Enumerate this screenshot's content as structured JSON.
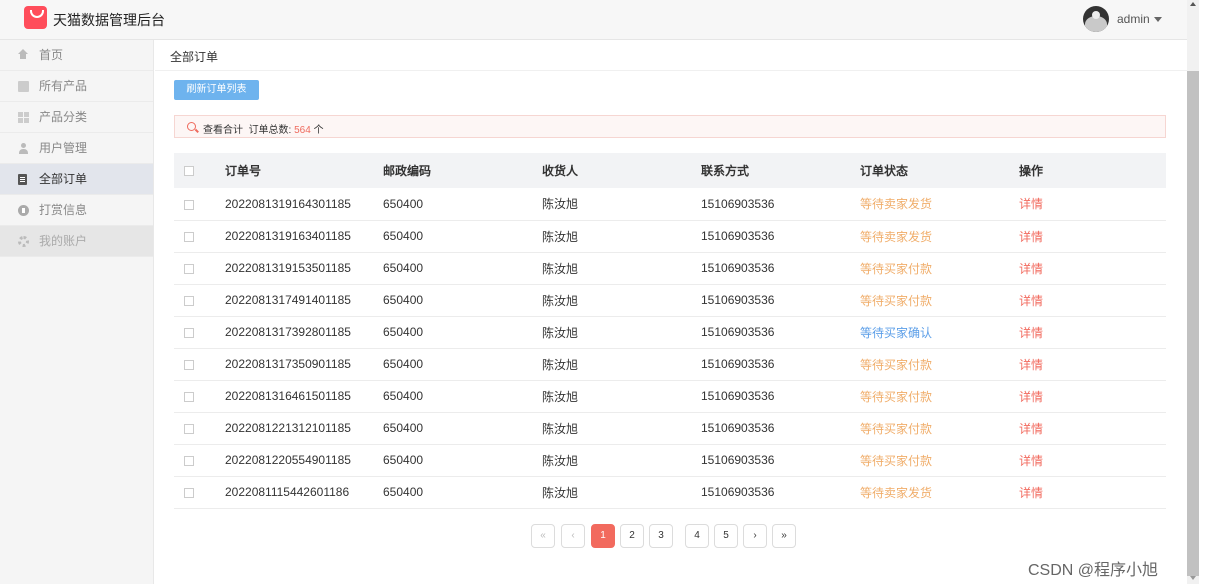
{
  "header": {
    "brand": "天猫数据管理后台",
    "username": "admin"
  },
  "sidebar": {
    "items": [
      {
        "label": "首页"
      },
      {
        "label": "所有产品"
      },
      {
        "label": "产品分类"
      },
      {
        "label": "用户管理"
      },
      {
        "label": "全部订单"
      },
      {
        "label": "打赏信息"
      },
      {
        "label": "我的账户"
      }
    ],
    "active": "全部订单"
  },
  "breadcrumb": "全部订单",
  "toolbar": {
    "refresh_label": "刷新订单列表"
  },
  "summary": {
    "prefix": "查看合计",
    "label": "订单总数:",
    "count": "564",
    "unit": "个"
  },
  "table": {
    "headers": [
      "订单号",
      "邮政编码",
      "收货人",
      "联系方式",
      "订单状态",
      "操作"
    ],
    "rows": [
      {
        "order_no": "2022081319164301185",
        "zip": "650400",
        "receiver": "陈汝旭",
        "phone": "15106903536",
        "status": "等待卖家发货",
        "status_color": "#f0ad6a",
        "action": "详情"
      },
      {
        "order_no": "2022081319163401185",
        "zip": "650400",
        "receiver": "陈汝旭",
        "phone": "15106903536",
        "status": "等待卖家发货",
        "status_color": "#f0ad6a",
        "action": "详情"
      },
      {
        "order_no": "2022081319153501185",
        "zip": "650400",
        "receiver": "陈汝旭",
        "phone": "15106903536",
        "status": "等待买家付款",
        "status_color": "#f0ad6a",
        "action": "详情"
      },
      {
        "order_no": "2022081317491401185",
        "zip": "650400",
        "receiver": "陈汝旭",
        "phone": "15106903536",
        "status": "等待买家付款",
        "status_color": "#f0ad6a",
        "action": "详情"
      },
      {
        "order_no": "2022081317392801185",
        "zip": "650400",
        "receiver": "陈汝旭",
        "phone": "15106903536",
        "status": "等待买家确认",
        "status_color": "#5b9ee8",
        "action": "详情"
      },
      {
        "order_no": "2022081317350901185",
        "zip": "650400",
        "receiver": "陈汝旭",
        "phone": "15106903536",
        "status": "等待买家付款",
        "status_color": "#f0ad6a",
        "action": "详情"
      },
      {
        "order_no": "2022081316461501185",
        "zip": "650400",
        "receiver": "陈汝旭",
        "phone": "15106903536",
        "status": "等待买家付款",
        "status_color": "#f0ad6a",
        "action": "详情"
      },
      {
        "order_no": "2022081221312101185",
        "zip": "650400",
        "receiver": "陈汝旭",
        "phone": "15106903536",
        "status": "等待买家付款",
        "status_color": "#f0ad6a",
        "action": "详情"
      },
      {
        "order_no": "2022081220554901185",
        "zip": "650400",
        "receiver": "陈汝旭",
        "phone": "15106903536",
        "status": "等待买家付款",
        "status_color": "#f0ad6a",
        "action": "详情"
      },
      {
        "order_no": "2022081115442601186",
        "zip": "650400",
        "receiver": "陈汝旭",
        "phone": "15106903536",
        "status": "等待卖家发货",
        "status_color": "#f0ad6a",
        "action": "详情"
      }
    ]
  },
  "pagination": {
    "first": "«",
    "prev": "‹",
    "pages": [
      "1",
      "2",
      "3",
      "4",
      "5"
    ],
    "current": "1",
    "next": "›",
    "last": "»"
  },
  "watermark": "CSDN @程序小旭"
}
